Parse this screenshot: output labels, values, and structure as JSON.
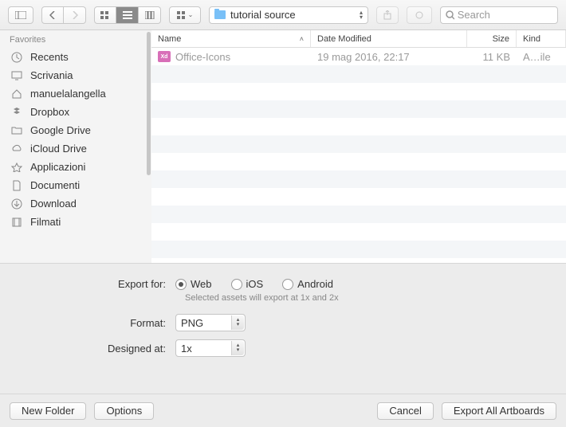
{
  "toolbar": {
    "path_label": "tutorial source",
    "search_placeholder": "Search"
  },
  "sidebar": {
    "header": "Favorites",
    "items": [
      {
        "label": "Recents",
        "icon": "clock"
      },
      {
        "label": "Scrivania",
        "icon": "desktop"
      },
      {
        "label": "manuelalangella",
        "icon": "home"
      },
      {
        "label": "Dropbox",
        "icon": "dropbox"
      },
      {
        "label": "Google Drive",
        "icon": "folder"
      },
      {
        "label": "iCloud Drive",
        "icon": "cloud"
      },
      {
        "label": "Applicazioni",
        "icon": "apps"
      },
      {
        "label": "Documenti",
        "icon": "document"
      },
      {
        "label": "Download",
        "icon": "download"
      },
      {
        "label": "Filmati",
        "icon": "film"
      }
    ]
  },
  "file_header": {
    "name": "Name",
    "date": "Date Modified",
    "size": "Size",
    "kind": "Kind"
  },
  "files": [
    {
      "name": "Office-Icons",
      "date": "19 mag 2016, 22:17",
      "size": "11 KB",
      "kind": "A…ile"
    }
  ],
  "export": {
    "export_for_label": "Export for:",
    "options": [
      "Web",
      "iOS",
      "Android"
    ],
    "selected_option": "Web",
    "hint": "Selected assets will export at 1x and 2x",
    "format_label": "Format:",
    "format_value": "PNG",
    "designed_label": "Designed at:",
    "designed_value": "1x"
  },
  "footer": {
    "new_folder": "New Folder",
    "options": "Options",
    "cancel": "Cancel",
    "export": "Export All Artboards"
  }
}
